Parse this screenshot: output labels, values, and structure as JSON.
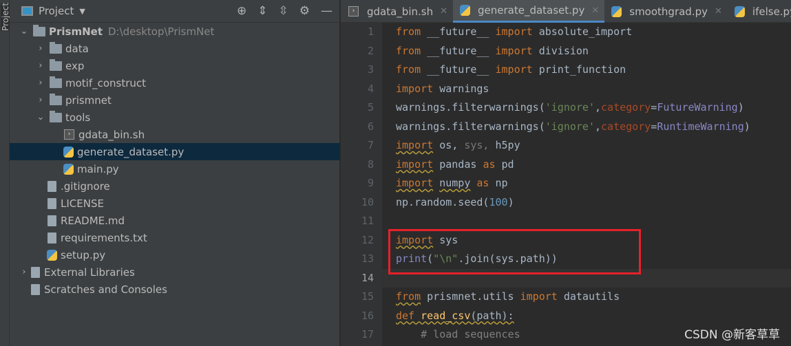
{
  "strip": {
    "label": "Project"
  },
  "panel": {
    "title": "Project",
    "icons": [
      "locate-icon",
      "expand-all-icon",
      "collapse-all-icon",
      "gear-icon",
      "minimize-icon"
    ],
    "tree": [
      {
        "label": "PrismNet",
        "path": "D:\\desktop\\PrismNet",
        "type": "folder",
        "depth": 0,
        "expanded": true
      },
      {
        "label": "data",
        "type": "folder",
        "depth": 1
      },
      {
        "label": "exp",
        "type": "folder",
        "depth": 1
      },
      {
        "label": "motif_construct",
        "type": "folder",
        "depth": 1
      },
      {
        "label": "prismnet",
        "type": "folder",
        "depth": 1
      },
      {
        "label": "tools",
        "type": "folder",
        "depth": 1,
        "expanded": true
      },
      {
        "label": "gdata_bin.sh",
        "type": "sh",
        "depth": 2
      },
      {
        "label": "generate_dataset.py",
        "type": "py",
        "depth": 2,
        "selected": true
      },
      {
        "label": "main.py",
        "type": "py",
        "depth": 2
      },
      {
        "label": ".gitignore",
        "type": "file",
        "depth": 1
      },
      {
        "label": "LICENSE",
        "type": "file",
        "depth": 1
      },
      {
        "label": "README.md",
        "type": "file",
        "depth": 1
      },
      {
        "label": "requirements.txt",
        "type": "file",
        "depth": 1
      },
      {
        "label": "setup.py",
        "type": "py",
        "depth": 1
      },
      {
        "label": "External Libraries",
        "type": "lib",
        "depth": 0
      },
      {
        "label": "Scratches and Consoles",
        "type": "scratch",
        "depth": 0
      }
    ]
  },
  "tabs": [
    {
      "label": "gdata_bin.sh"
    },
    {
      "label": "generate_dataset.py",
      "active": true
    },
    {
      "label": "smoothgrad.py"
    },
    {
      "label": "ifelse.py"
    }
  ],
  "editor": {
    "current_line": 14,
    "line_numbers": [
      "1",
      "2",
      "3",
      "4",
      "5",
      "6",
      "7",
      "8",
      "9",
      "10",
      "11",
      "12",
      "13",
      "14",
      "15",
      "16",
      "17"
    ]
  },
  "watermark": "CSDN @新客草草",
  "colors": {
    "highlight_box": "#e8202a",
    "keyword": "#cc7832",
    "string": "#6a8759",
    "selection": "#0d293e"
  }
}
